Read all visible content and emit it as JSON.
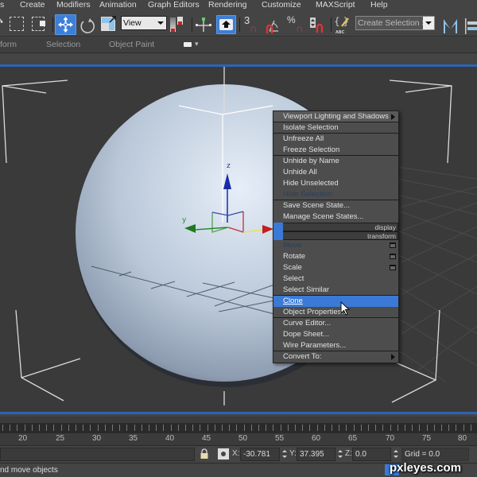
{
  "menubar": {
    "items": [
      "s",
      "Create",
      "Modifiers",
      "Animation",
      "Graph Editors",
      "Rendering",
      "Customize",
      "MAXScript",
      "Help"
    ]
  },
  "toolbar": {
    "reference_coord": "View",
    "snap_angle_label": "3",
    "percent_label": "%",
    "named_selection_set": "Create Selection Se",
    "accent_color": "#3d7fd8"
  },
  "ribbon": {
    "tabs": [
      "form",
      "Selection",
      "Object Paint"
    ]
  },
  "viewport": {
    "gizmo_axes": [
      "x",
      "y",
      "z"
    ]
  },
  "quad_menu": {
    "display_label": "display",
    "transform_label": "transform",
    "display_items": [
      {
        "label": "Viewport Lighting and Shadows",
        "submenu": true,
        "state": "normal"
      },
      {
        "label": "Isolate Selection",
        "state": "normal"
      },
      {
        "label": "Unfreeze All",
        "state": "normal"
      },
      {
        "label": "Freeze Selection",
        "state": "normal"
      },
      {
        "label": "Unhide by Name",
        "state": "normal"
      },
      {
        "label": "Unhide All",
        "state": "normal"
      },
      {
        "label": "Hide Unselected",
        "state": "normal"
      },
      {
        "label": "Hide Selection",
        "state": "disabled"
      },
      {
        "label": "Save Scene State...",
        "state": "normal"
      },
      {
        "label": "Manage Scene States...",
        "state": "normal"
      }
    ],
    "transform_items": [
      {
        "label": "Move",
        "state": "disabled",
        "options": true
      },
      {
        "label": "Rotate",
        "state": "normal",
        "options": true
      },
      {
        "label": "Scale",
        "state": "normal",
        "options": true
      },
      {
        "label": "Select",
        "state": "normal"
      },
      {
        "label": "Select Similar",
        "state": "normal"
      },
      {
        "label": "Clone",
        "state": "highlighted"
      },
      {
        "label": "Object Properties...",
        "state": "normal"
      },
      {
        "label": "Curve Editor...",
        "state": "normal"
      },
      {
        "label": "Dope Sheet...",
        "state": "normal"
      },
      {
        "label": "Wire Parameters...",
        "state": "normal"
      },
      {
        "label": "Convert To:",
        "submenu": true,
        "state": "normal"
      }
    ]
  },
  "timeline": {
    "labels": [
      "20",
      "25",
      "30",
      "35",
      "40",
      "45",
      "50",
      "55",
      "60",
      "65",
      "70",
      "75",
      "80"
    ]
  },
  "status": {
    "x_label": "X:",
    "x_value": "-30.781",
    "y_label": "Y:",
    "y_value": "37.395",
    "z_label": "Z:",
    "z_value": "0.0",
    "grid": "Grid = 0.0",
    "prompt": "nd move objects"
  },
  "watermark": "pxleyes.com"
}
